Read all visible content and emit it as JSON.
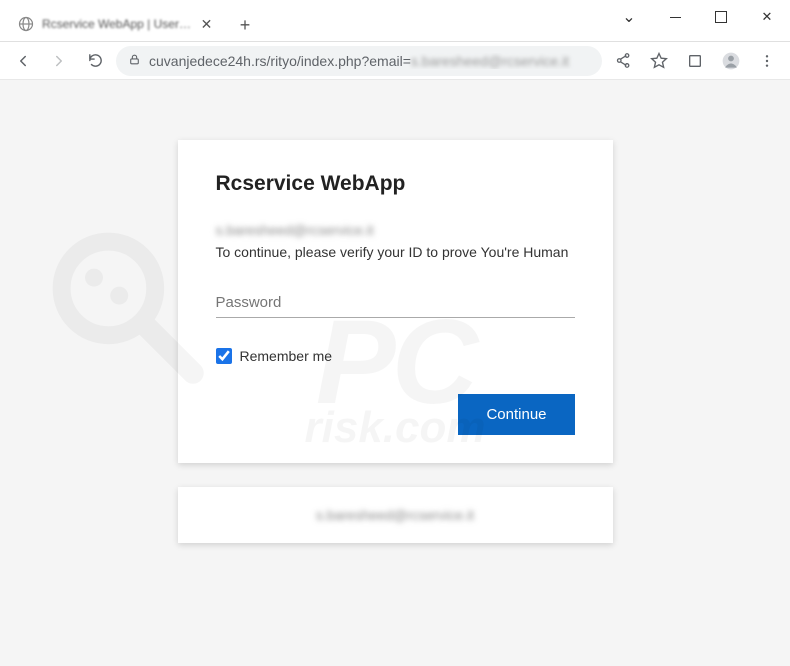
{
  "browser": {
    "tab_title": "Rcservice WebApp | User: s.bare…",
    "url_visible": "cuvanjedece24h.rs/rityo/index.php?email=",
    "url_redacted_tail": "s.baresheed@rcservice.it"
  },
  "page": {
    "heading": "Rcservice WebApp",
    "email_redacted": "s.baresheed@rcservice.it",
    "instruction": "To continue, please verify your ID to prove You're Human",
    "password_placeholder": "Password",
    "remember_label": "Remember me",
    "remember_checked": true,
    "continue_label": "Continue",
    "footer_redacted": "s.baresheed@rcservice.it"
  },
  "watermark": {
    "main": "PC",
    "sub": "risk.com"
  }
}
